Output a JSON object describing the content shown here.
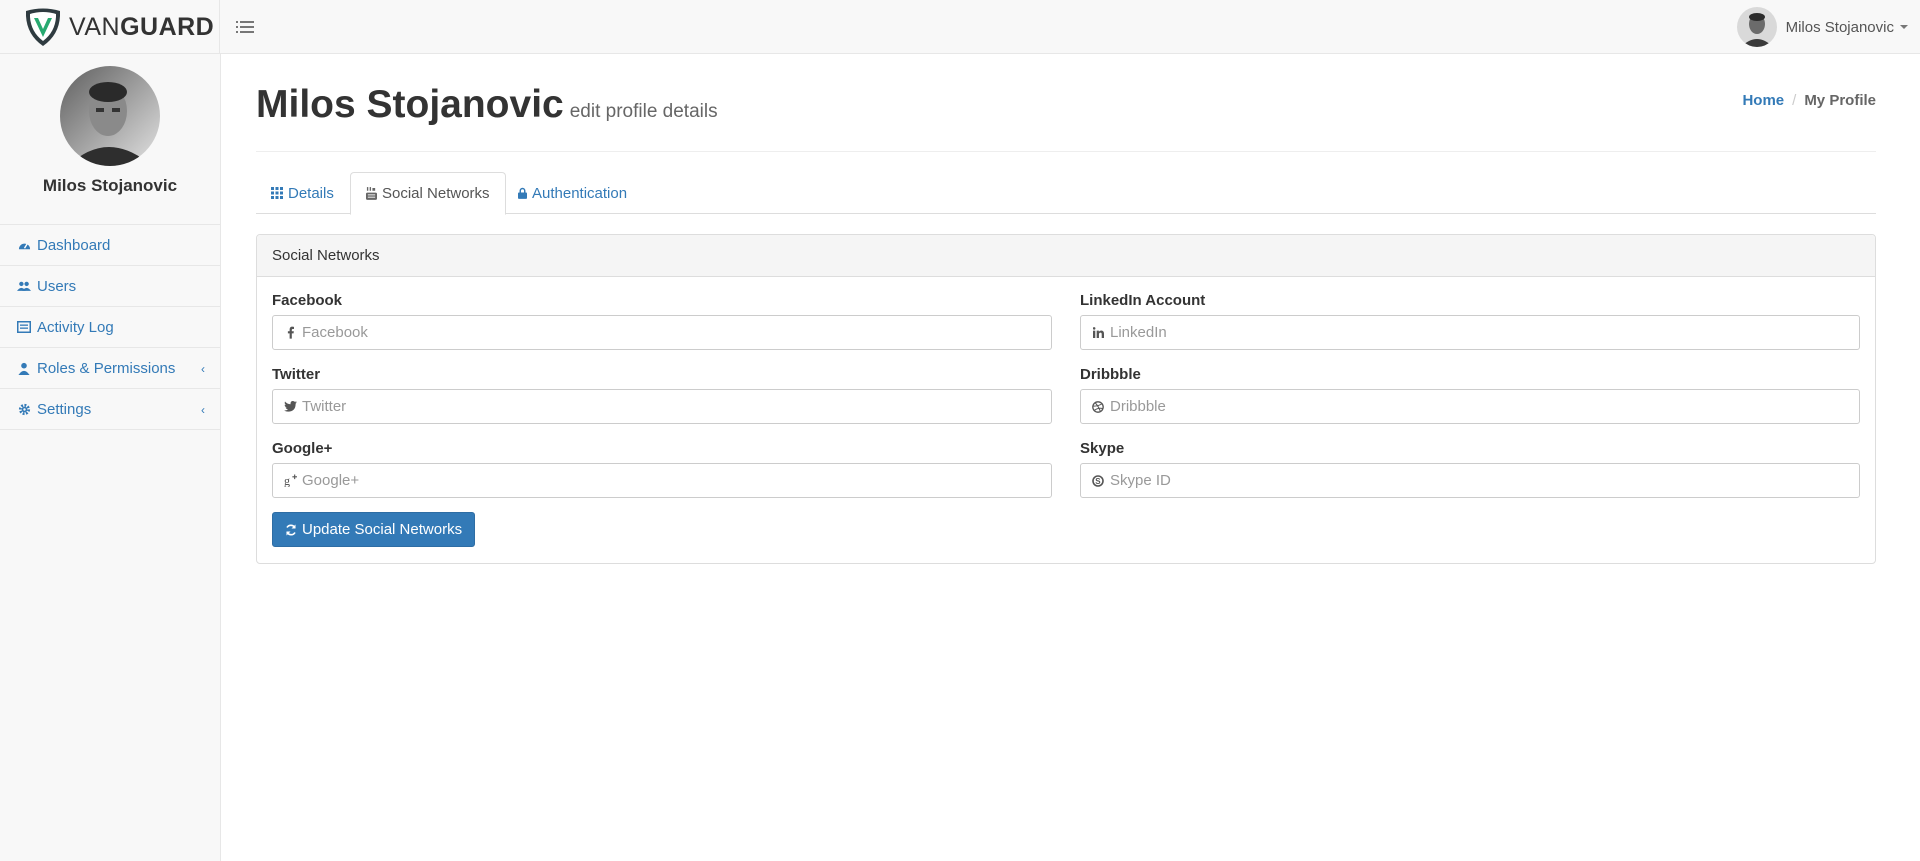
{
  "brand": {
    "part1": "VAN",
    "part2": "GUARD"
  },
  "user": {
    "name": "Milos Stojanovic"
  },
  "sidebar": {
    "profile_name": "Milos Stojanovic",
    "items": [
      {
        "label": "Dashboard",
        "icon": "dashboard-icon"
      },
      {
        "label": "Users",
        "icon": "users-icon"
      },
      {
        "label": "Activity Log",
        "icon": "activity-log-icon"
      },
      {
        "label": "Roles & Permissions",
        "icon": "user-icon"
      },
      {
        "label": "Settings",
        "icon": "gear-icon"
      }
    ]
  },
  "header": {
    "title": "Milos Stojanovic",
    "subtitle": "edit profile details"
  },
  "breadcrumb": {
    "home": "Home",
    "separator": "/",
    "current": "My Profile"
  },
  "tabs": [
    {
      "label": "Details",
      "icon": "grid-icon"
    },
    {
      "label": "Social Networks",
      "icon": "youtube-icon",
      "active": true
    },
    {
      "label": "Authentication",
      "icon": "lock-icon"
    }
  ],
  "panel": {
    "title": "Social Networks",
    "fields": {
      "facebook": {
        "label": "Facebook",
        "placeholder": "Facebook",
        "value": ""
      },
      "linkedin": {
        "label": "LinkedIn Account",
        "placeholder": "LinkedIn",
        "value": ""
      },
      "twitter": {
        "label": "Twitter",
        "placeholder": "Twitter",
        "value": ""
      },
      "dribbble": {
        "label": "Dribbble",
        "placeholder": "Dribbble",
        "value": ""
      },
      "google": {
        "label": "Google+",
        "placeholder": "Google+",
        "value": ""
      },
      "skype": {
        "label": "Skype",
        "placeholder": "Skype ID",
        "value": ""
      }
    },
    "button_label": "Update Social Networks"
  },
  "colors": {
    "link": "#337ab7",
    "primary": "#337ab7",
    "shield_green": "#27a970"
  }
}
